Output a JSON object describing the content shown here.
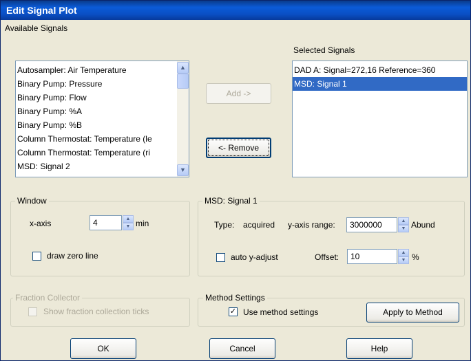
{
  "window": {
    "title": "Edit Signal Plot"
  },
  "available_signals": {
    "label": "Available Signals",
    "items": [
      "Autosampler: Air Temperature",
      "Binary Pump: Pressure",
      "Binary Pump: Flow",
      "Binary Pump: %A",
      "Binary Pump: %B",
      "Column Thermostat: Temperature (le",
      "Column Thermostat: Temperature (ri",
      "MSD: Signal 2"
    ]
  },
  "selected_signals": {
    "label": "Selected Signals",
    "items": [
      {
        "text": "DAD A: Signal=272,16  Reference=360",
        "selected": false
      },
      {
        "text": "MSD: Signal 1",
        "selected": true
      }
    ]
  },
  "buttons": {
    "add": "Add ->",
    "remove": "<- Remove",
    "apply": "Apply to Method",
    "ok": "OK",
    "cancel": "Cancel",
    "help": "Help"
  },
  "window_group": {
    "title": "Window",
    "xaxis_label": "x-axis",
    "xaxis_value": "4",
    "xaxis_unit": "min",
    "draw_zero_label": "draw zero line",
    "draw_zero_checked": false
  },
  "signal_group": {
    "title": "MSD: Signal 1",
    "type_label": "Type:",
    "type_value": "acquired",
    "yrange_label": "y-axis range:",
    "yrange_value": "3000000",
    "yrange_unit": "Abund",
    "auto_adjust_label": "auto y-adjust",
    "auto_adjust_checked": false,
    "offset_label": "Offset:",
    "offset_value": "10",
    "offset_unit": "%"
  },
  "fraction_group": {
    "title": "Fraction Collector",
    "ticks_label": "Show fraction collection ticks",
    "enabled": false
  },
  "method_group": {
    "title": "Method Settings",
    "use_method_label": "Use method settings",
    "use_method_checked": true,
    "check_glyph": "✓"
  }
}
